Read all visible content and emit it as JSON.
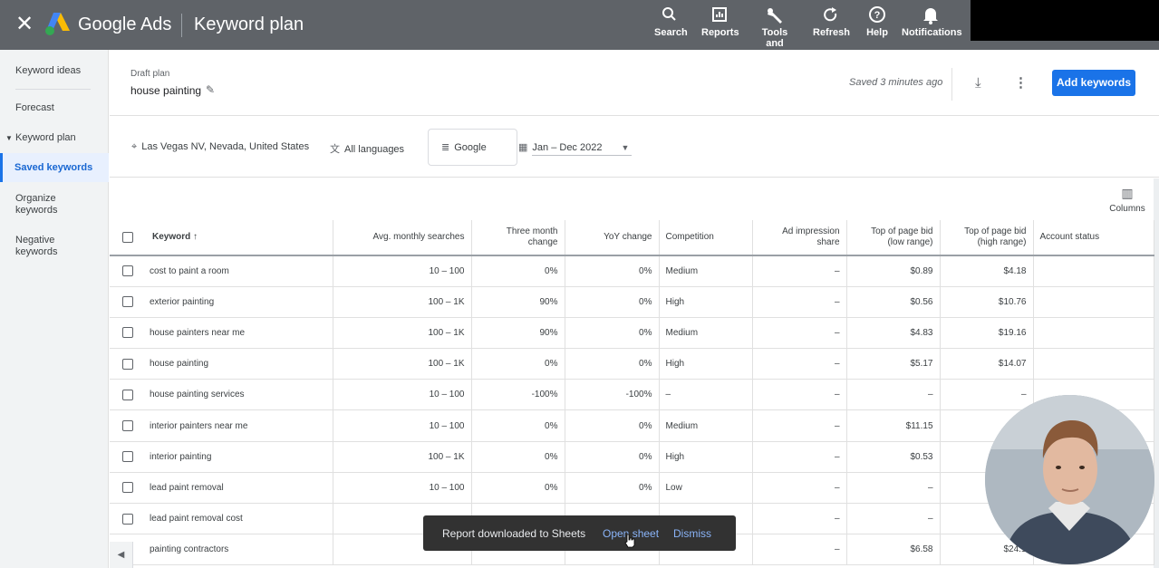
{
  "topbar": {
    "close_icon": "close-icon",
    "brand": "Google Ads",
    "page_title": "Keyword plan",
    "tools": [
      {
        "label": "Search",
        "icon": "search-icon"
      },
      {
        "label": "Reports",
        "icon": "reports-icon"
      },
      {
        "label": "Tools and settings",
        "icon": "wrench-icon"
      },
      {
        "label": "Refresh",
        "icon": "refresh-icon"
      },
      {
        "label": "Help",
        "icon": "help-icon"
      },
      {
        "label": "Notifications",
        "icon": "bell-icon"
      }
    ]
  },
  "sidebar": {
    "items": [
      {
        "label": "Keyword ideas"
      },
      {
        "label": "Forecast"
      },
      {
        "label": "Keyword plan"
      },
      {
        "label": "Saved keywords"
      },
      {
        "label": "Organize keywords"
      },
      {
        "label": "Negative keywords"
      }
    ]
  },
  "header": {
    "draft_label": "Draft plan",
    "plan_name": "house painting",
    "saved_status": "Saved 3 minutes ago",
    "add_button": "Add keywords"
  },
  "filters": {
    "location": "Las Vegas NV, Nevada, United States",
    "language": "All languages",
    "network": "Google",
    "date_range": "Jan – Dec 2022"
  },
  "table": {
    "columns_label": "Columns",
    "headers": {
      "keyword": "Keyword",
      "avg": "Avg. monthly searches",
      "three_month": "Three month change",
      "yoy": "YoY change",
      "competition": "Competition",
      "ad_share": "Ad impression share",
      "bid_low": "Top of page bid (low range)",
      "bid_high": "Top of page bid (high range)",
      "account": "Account status"
    },
    "rows": [
      {
        "keyword": "cost to paint a room",
        "avg": "10 – 100",
        "three": "0%",
        "yoy": "0%",
        "comp": "Medium",
        "share": "–",
        "low": "$0.89",
        "high": "$4.18",
        "acct": ""
      },
      {
        "keyword": "exterior painting",
        "avg": "100 – 1K",
        "three": "90%",
        "yoy": "0%",
        "comp": "High",
        "share": "–",
        "low": "$0.56",
        "high": "$10.76",
        "acct": ""
      },
      {
        "keyword": "house painters near me",
        "avg": "100 – 1K",
        "three": "90%",
        "yoy": "0%",
        "comp": "Medium",
        "share": "–",
        "low": "$4.83",
        "high": "$19.16",
        "acct": ""
      },
      {
        "keyword": "house painting",
        "avg": "100 – 1K",
        "three": "0%",
        "yoy": "0%",
        "comp": "High",
        "share": "–",
        "low": "$5.17",
        "high": "$14.07",
        "acct": ""
      },
      {
        "keyword": "house painting services",
        "avg": "10 – 100",
        "three": "-100%",
        "yoy": "-100%",
        "comp": "–",
        "share": "–",
        "low": "–",
        "high": "–",
        "acct": ""
      },
      {
        "keyword": "interior painters near me",
        "avg": "10 – 100",
        "three": "0%",
        "yoy": "0%",
        "comp": "Medium",
        "share": "–",
        "low": "$11.15",
        "high": "",
        "acct": ""
      },
      {
        "keyword": "interior painting",
        "avg": "100 – 1K",
        "three": "0%",
        "yoy": "0%",
        "comp": "High",
        "share": "–",
        "low": "$0.53",
        "high": "",
        "acct": ""
      },
      {
        "keyword": "lead paint removal",
        "avg": "10 – 100",
        "three": "0%",
        "yoy": "0%",
        "comp": "Low",
        "share": "–",
        "low": "–",
        "high": "",
        "acct": ""
      },
      {
        "keyword": "lead paint removal cost",
        "avg": "",
        "three": "",
        "yoy": "",
        "comp": "",
        "share": "–",
        "low": "–",
        "high": "",
        "acct": ""
      },
      {
        "keyword": "painting contractors",
        "avg": "",
        "three": "",
        "yoy": "",
        "comp": "",
        "share": "–",
        "low": "$6.58",
        "high": "$24.1",
        "acct": ""
      }
    ]
  },
  "snackbar": {
    "message": "Report downloaded to Sheets",
    "open_action": "Open sheet",
    "dismiss_action": "Dismiss"
  },
  "colors": {
    "topbar": "#5f6368",
    "accent": "#1a73e8",
    "snackbar": "#323232",
    "snackbar_link": "#8ab4f8"
  }
}
